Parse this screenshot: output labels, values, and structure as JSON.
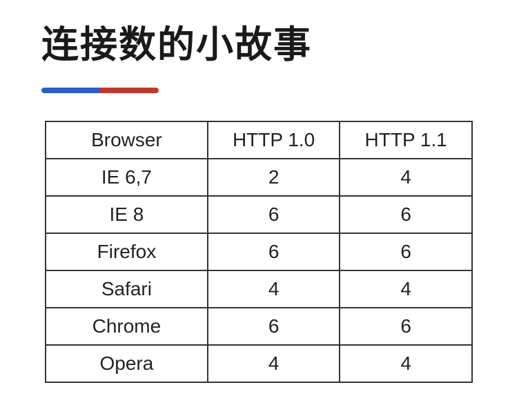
{
  "title": "连接数的小故事",
  "table": {
    "headers": [
      "Browser",
      "HTTP 1.0",
      "HTTP 1.1"
    ],
    "rows": [
      {
        "browser": "IE 6,7",
        "http10": "2",
        "http11": "4"
      },
      {
        "browser": "IE 8",
        "http10": "6",
        "http11": "6"
      },
      {
        "browser": "Firefox",
        "http10": "6",
        "http11": "6"
      },
      {
        "browser": "Safari",
        "http10": "4",
        "http11": "4"
      },
      {
        "browser": "Chrome",
        "http10": "6",
        "http11": "6"
      },
      {
        "browser": "Opera",
        "http10": "4",
        "http11": "4"
      }
    ]
  },
  "chart_data": {
    "type": "table",
    "title": "连接数的小故事",
    "columns": [
      "Browser",
      "HTTP 1.0",
      "HTTP 1.1"
    ],
    "rows": [
      [
        "IE 6,7",
        2,
        4
      ],
      [
        "IE 8",
        6,
        6
      ],
      [
        "Firefox",
        6,
        6
      ],
      [
        "Safari",
        4,
        4
      ],
      [
        "Chrome",
        6,
        6
      ],
      [
        "Opera",
        4,
        4
      ]
    ]
  }
}
